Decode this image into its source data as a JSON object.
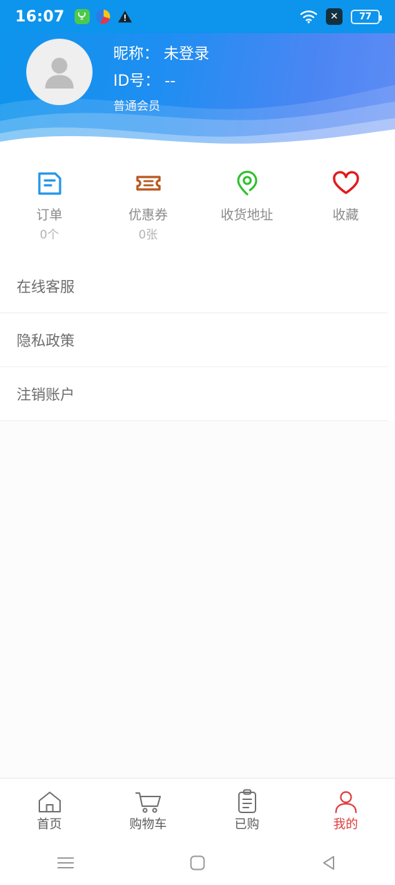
{
  "statusbar": {
    "time": "16:07",
    "battery_percent": "77",
    "icons": [
      "fitness-app-icon",
      "colorful-app-icon",
      "warning-triangle-icon",
      "wifi-icon",
      "no-signal-x-icon",
      "battery-icon"
    ]
  },
  "header": {
    "nickname_line": "昵称： 未登录",
    "id_line": "ID号： --",
    "member_level": "普通会员",
    "avatar_alt": "default-avatar",
    "bg_color_left": "#0d94ec",
    "bg_color_right": "#5e8cf5"
  },
  "quick_actions": [
    {
      "label": "订单",
      "count": "0个",
      "icon": "order-document-icon",
      "color": "#2196e8"
    },
    {
      "label": "优惠券",
      "count": "0张",
      "icon": "coupon-ticket-icon",
      "color": "#b9581f"
    },
    {
      "label": "收货地址",
      "count": "",
      "icon": "location-pin-icon",
      "color": "#2fbf2f"
    },
    {
      "label": "收藏",
      "count": "",
      "icon": "heart-icon",
      "color": "#e01b1b"
    }
  ],
  "menu": [
    {
      "label": "在线客服"
    },
    {
      "label": "隐私政策"
    },
    {
      "label": "注销账户"
    }
  ],
  "tabbar": {
    "active_color": "#e03c3c",
    "inactive_color": "#5c5c5c",
    "tabs": [
      {
        "label": "首页",
        "icon": "home-icon",
        "active": false
      },
      {
        "label": "购物车",
        "icon": "cart-icon",
        "active": false
      },
      {
        "label": "已购",
        "icon": "clipboard-icon",
        "active": false
      },
      {
        "label": "我的",
        "icon": "person-icon",
        "active": true
      }
    ]
  },
  "navbar": {
    "buttons": [
      {
        "icon": "recents-menu-icon"
      },
      {
        "icon": "home-square-icon"
      },
      {
        "icon": "back-triangle-icon"
      }
    ]
  }
}
